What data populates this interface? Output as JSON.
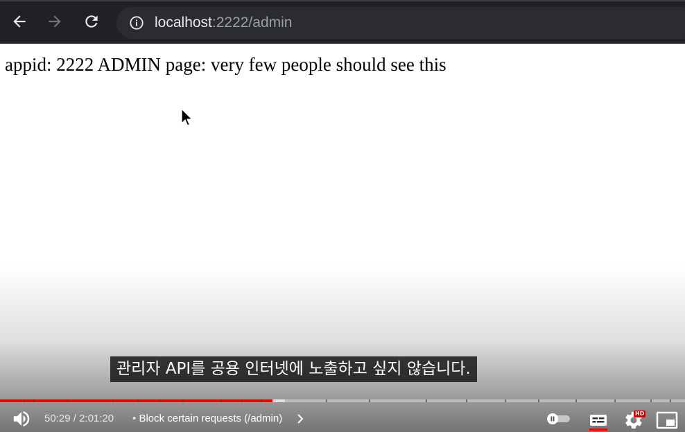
{
  "browser": {
    "url_host": "localhost",
    "url_path": ":2222/admin"
  },
  "page": {
    "text": "appid: 2222 ADMIN page: very few people should see this"
  },
  "video": {
    "subtitle": "관리자 API를 공용 인터넷에 노출하고 싶지 않습니다.",
    "time_current": "50:29",
    "time_separator": " / ",
    "time_total": "2:01:20",
    "chapter_separator": "•",
    "chapter_title": "Block certain requests (/admin)",
    "hd_badge": "HD",
    "progress_played": 0.398,
    "progress_buffered": 0.416,
    "accent_color": "#ff0000"
  },
  "icons": {
    "back": "arrow-left-icon",
    "forward": "arrow-right-icon",
    "reload": "reload-icon",
    "site_info": "info-icon",
    "volume": "volume-icon",
    "chevron": "chevron-right-icon",
    "autoplay": "toggle-pause-icon",
    "captions": "captions-icon",
    "settings": "gear-icon",
    "miniplayer": "miniplayer-icon"
  }
}
